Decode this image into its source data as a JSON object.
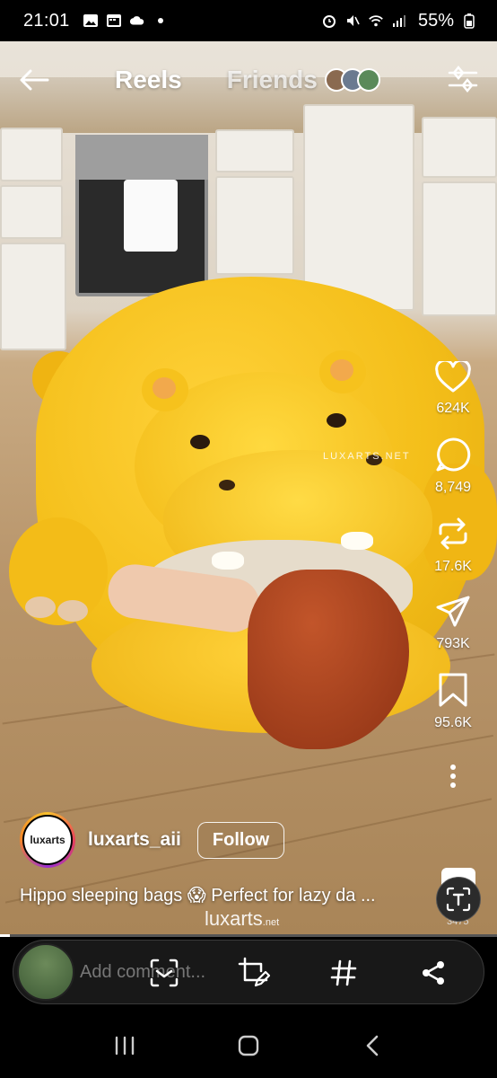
{
  "status_bar": {
    "time": "21:01",
    "battery": "55%"
  },
  "header": {
    "tab_reels": "Reels",
    "tab_friends": "Friends"
  },
  "video": {
    "watermark": "LUXARTS.NET",
    "brand_mark": "luxarts",
    "brand_mark_suffix": ".net"
  },
  "actions": {
    "likes": "624K",
    "comments": "8,749",
    "reposts": "17.6K",
    "shares": "793K",
    "saves": "95.6K"
  },
  "author": {
    "avatar_text": "luxarts",
    "username": "luxarts_aii",
    "follow_label": "Follow"
  },
  "caption": "Hippo sleeping bags 😱 Perfect for lazy da ...",
  "audio": {
    "count": "3475"
  },
  "composer": {
    "placeholder": "Add comment..."
  },
  "progress": 0.02,
  "colors": {
    "accent": "#ffffff",
    "hippo": "#f4bf1a"
  }
}
